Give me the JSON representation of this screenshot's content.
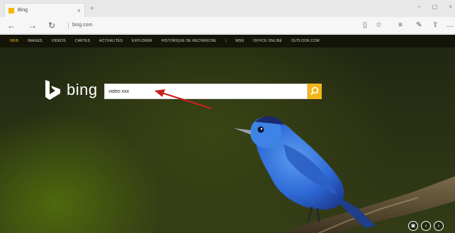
{
  "browser": {
    "tab_title": "Bing",
    "tab_close": "×",
    "new_tab": "+",
    "url": "bing.com",
    "win_controls": [
      "–",
      "▢",
      "×"
    ]
  },
  "bing_nav": {
    "items": [
      "WEB",
      "IMAGES",
      "VIDÉOS",
      "CARTES",
      "ACTUALITÉS",
      "EXPLORER",
      "HISTORIQUE DE RECHERCHE",
      "|",
      "MSN",
      "OFFICE ONLINE",
      "OUTLOOK.COM"
    ]
  },
  "logo": {
    "text": "bing"
  },
  "search": {
    "value": "vidéo xxx"
  },
  "colors": {
    "accent": "#f2b51d",
    "nav_bg": "#141508"
  }
}
